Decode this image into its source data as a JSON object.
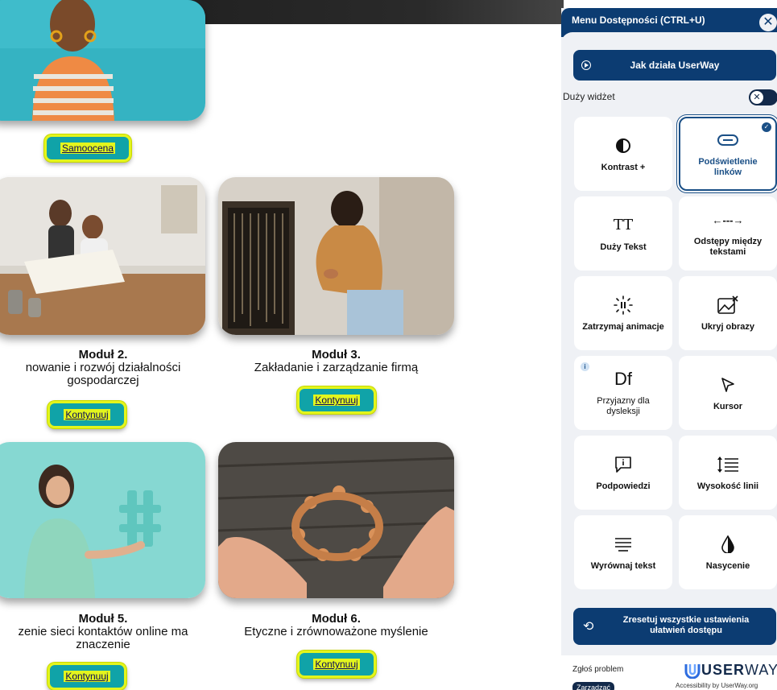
{
  "modules": {
    "m1": {
      "button": "Samoocena"
    },
    "m2": {
      "title": "Moduł 2.",
      "subtitle": "nowanie i rozwój działalności gospodarczej",
      "button": "Kontynuuj"
    },
    "m3": {
      "title": "Moduł 3.",
      "subtitle": "Zakładanie i zarządzanie firmą",
      "button": "Kontynuuj"
    },
    "m5": {
      "title": "Moduł 5.",
      "subtitle": "zenie sieci kontaktów online ma znaczenie",
      "button": "Kontynuuj"
    },
    "m6": {
      "title": "Moduł 6.",
      "subtitle": "Etyczne i zrównoważone myślenie",
      "button": "Kontynuuj"
    }
  },
  "panel": {
    "title": "Menu Dostępności (CTRL+U)",
    "close": "✕",
    "howto": "Jak działa UserWay",
    "big_widget": "Duży widżet",
    "toggle_state": "off",
    "tiles": [
      {
        "label": "Kontrast +",
        "icon": "contrast-icon",
        "active": false
      },
      {
        "label": "Podświetlenie linków",
        "icon": "link-icon",
        "active": true
      },
      {
        "label": "Duży Tekst",
        "icon": "text-size-icon",
        "active": false
      },
      {
        "label": "Odstępy między tekstami",
        "icon": "text-spacing-icon",
        "active": false
      },
      {
        "label": "Zatrzymaj animacje",
        "icon": "pause-animation-icon",
        "active": false
      },
      {
        "label": "Ukryj obrazy",
        "icon": "hide-images-icon",
        "active": false
      },
      {
        "label": "Przyjazny dla dysleksji",
        "icon": "dyslexia-font-icon",
        "active": false
      },
      {
        "label": "Kursor",
        "icon": "cursor-icon",
        "active": false
      },
      {
        "label": "Podpowiedzi",
        "icon": "tooltip-icon",
        "active": false
      },
      {
        "label": "Wysokość linii",
        "icon": "line-height-icon",
        "active": false
      },
      {
        "label": "Wyrównaj tekst",
        "icon": "align-text-icon",
        "active": false
      },
      {
        "label": "Nasycenie",
        "icon": "saturation-icon",
        "active": false
      }
    ],
    "tile_glyphs": {
      "text_size": "TT",
      "spacing": "←---→",
      "dyslexia": "Df",
      "info": "i",
      "check": "✓"
    },
    "reset": "Zresetuj wszystkie ustawienia ułatwień dostępu",
    "report": "Zgłoś problem",
    "manage": "Zarządzać",
    "logo": {
      "bold": "USER",
      "light": "WAY"
    },
    "tagline": "Accessibility by UserWay.org"
  },
  "colors": {
    "panel_navy": "#0c3c72",
    "cta_teal": "#10a3a8",
    "cta_yellow": "#e3f51d"
  }
}
